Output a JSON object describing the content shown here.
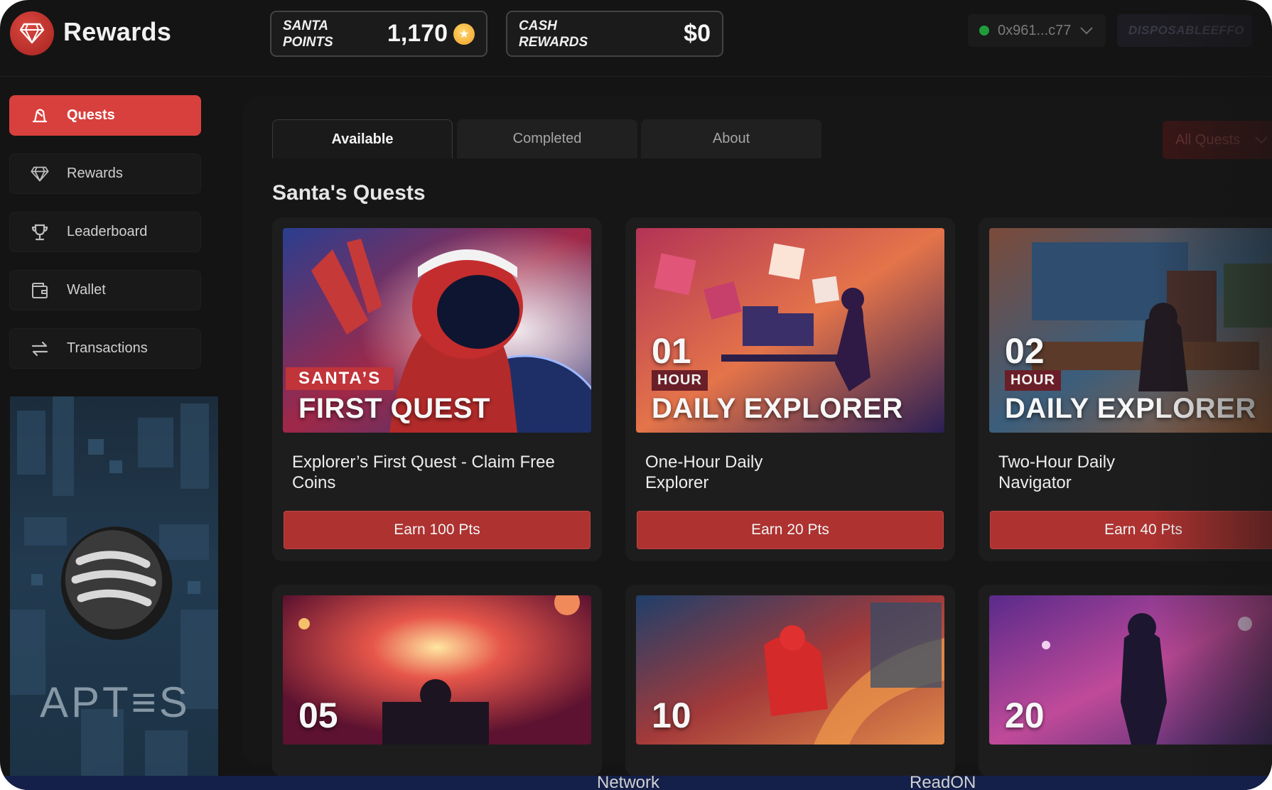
{
  "app": {
    "title": "Rewards"
  },
  "header": {
    "santa_points_label": "SANTA\nPOINTS",
    "santa_points_value": "1,170",
    "cash_rewards_label": "CASH\nREWARDS",
    "cash_rewards_value": "$0",
    "wallet_address": "0x961...c77",
    "disposable_label": "DISPOSABLEEFFO"
  },
  "sidebar": {
    "items": [
      {
        "label": "Quests",
        "icon": "quest-icon",
        "active": true
      },
      {
        "label": "Rewards",
        "icon": "diamond-icon"
      },
      {
        "label": "Leaderboard",
        "icon": "trophy-icon"
      },
      {
        "label": "Wallet",
        "icon": "wallet-icon"
      },
      {
        "label": "Transactions",
        "icon": "transfer-icon"
      }
    ],
    "promo_text": "APT≡S"
  },
  "tabs": [
    {
      "label": "Available",
      "active": true
    },
    {
      "label": "Completed"
    },
    {
      "label": "About"
    }
  ],
  "filter": {
    "label": "All Quests"
  },
  "section_title": "Santa's Quests",
  "quests": [
    {
      "tag": "SANTA’S",
      "caption": "FIRST QUEST",
      "title": "Explorer’s First Quest - Claim Free Coins",
      "button": "Earn 100 Pts"
    },
    {
      "number": "01",
      "unit": "HOUR",
      "caption": "DAILY EXPLORER",
      "title": "One-Hour Daily Explorer",
      "button": "Earn 20 Pts"
    },
    {
      "number": "02",
      "unit": "HOUR",
      "caption": "DAILY EXPLORER",
      "title": "Two-Hour Daily Navigator",
      "button": "Earn 40 Pts"
    },
    {
      "number": "05"
    },
    {
      "number": "10"
    },
    {
      "number": "20"
    }
  ],
  "footer_strip": {
    "left": "Network",
    "right": "ReadON"
  },
  "colors": {
    "accent": "#d8403d",
    "button": "#ad3230",
    "background": "#141414",
    "card": "#1d1d1d"
  }
}
